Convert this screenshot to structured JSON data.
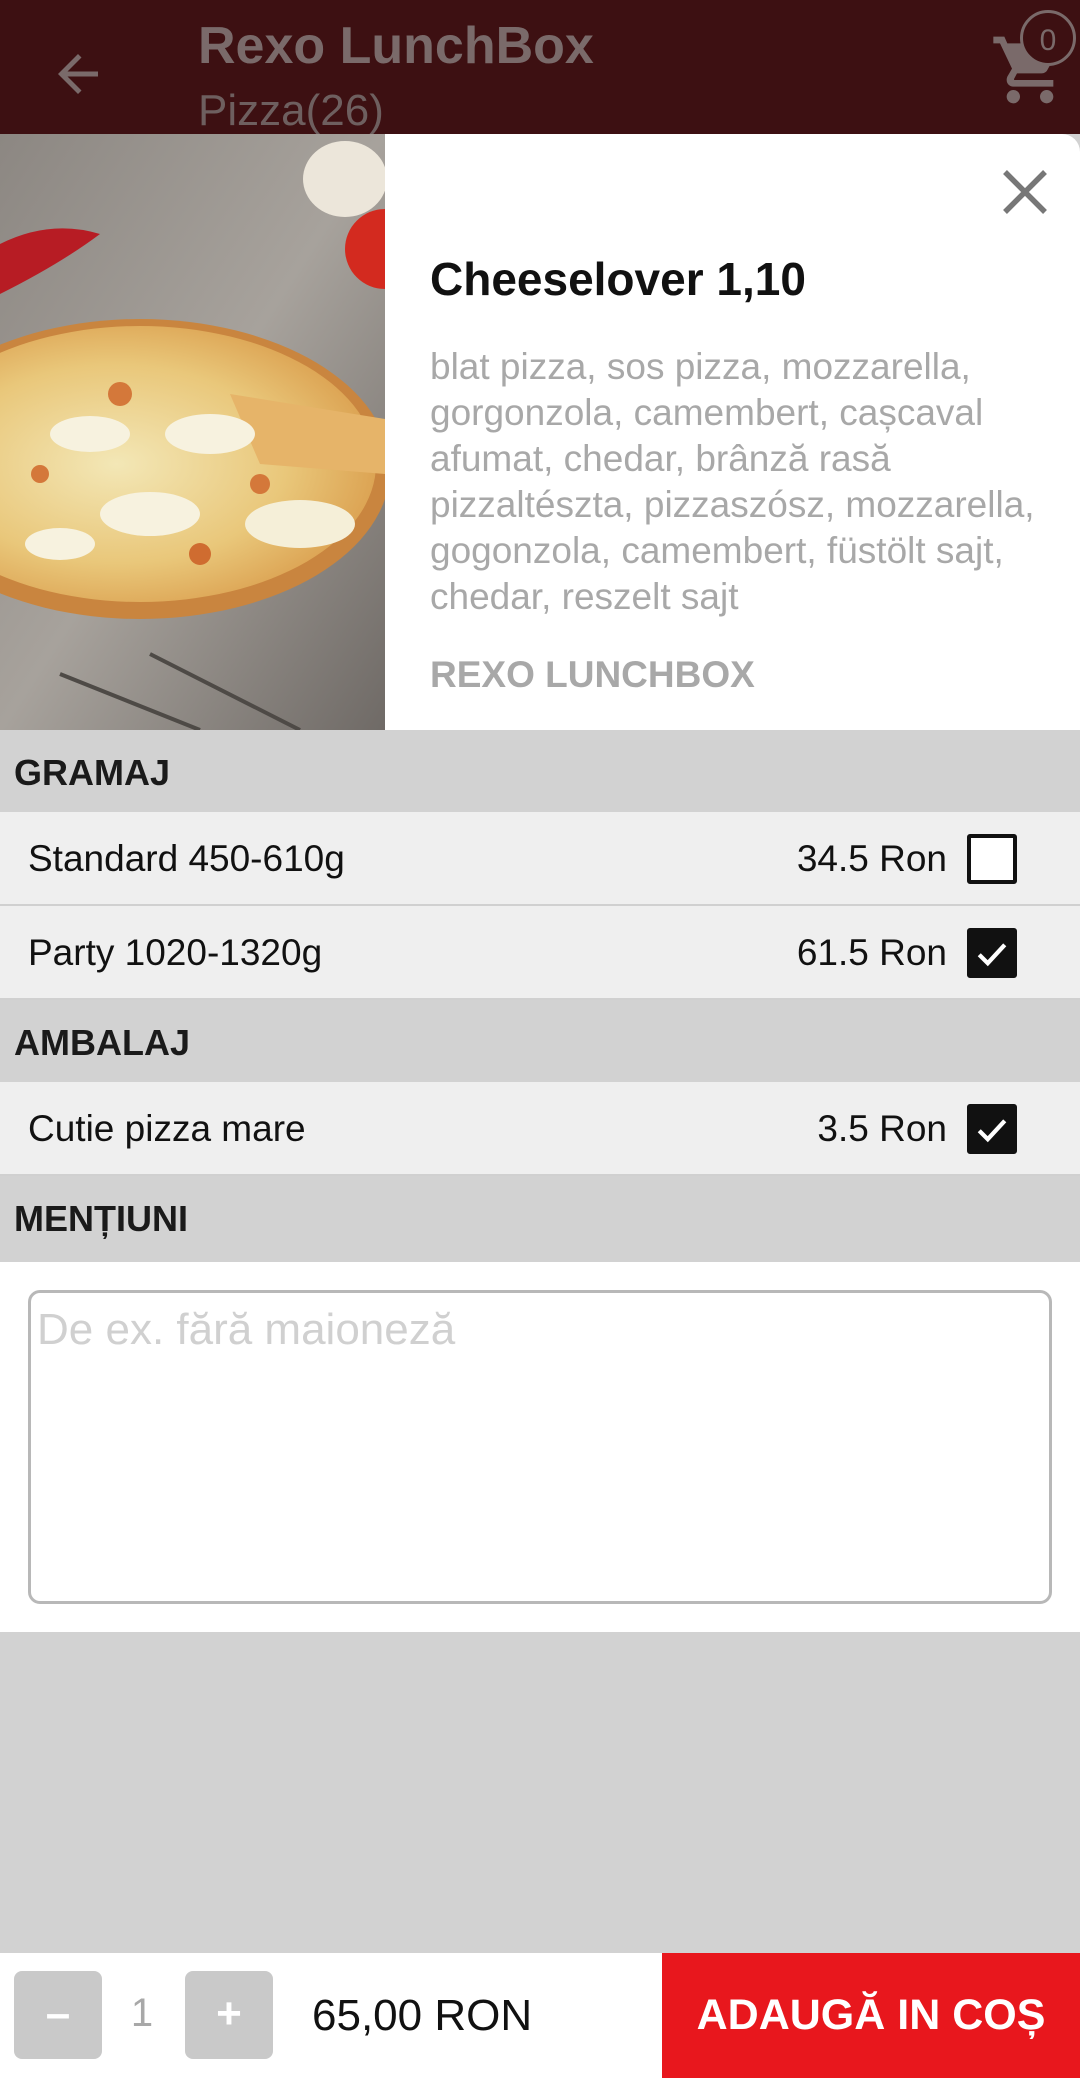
{
  "appbar": {
    "title": "Rexo LunchBox",
    "subtitle": "Pizza(26)",
    "cart_count": "0"
  },
  "product": {
    "name": "Cheeselover 1,10",
    "description": "blat pizza, sos pizza, mozzarella,\ngorgonzola, camembert, cașcaval\nafumat, chedar, brânză rasă\npizzaltészta, pizzaszósz, mozzarella,\ngogonzola, camembert, füstölt sajt,\nchedar, reszelt sajt",
    "vendor": "REXO LUNCHBOX"
  },
  "sections": {
    "gramaj": {
      "title": "GRAMAJ",
      "options": [
        {
          "label": "Standard 450-610g",
          "price": "34.5 Ron",
          "checked": false
        },
        {
          "label": "Party 1020-1320g",
          "price": "61.5 Ron",
          "checked": true
        }
      ]
    },
    "ambalaj": {
      "title": "AMBALAJ",
      "options": [
        {
          "label": "Cutie pizza mare",
          "price": "3.5 Ron",
          "checked": true
        }
      ]
    },
    "mentiuni": {
      "title": "MENȚIUNI",
      "placeholder": "De ex. fără maioneză",
      "value": ""
    }
  },
  "bottom": {
    "minus": "–",
    "quantity": "1",
    "plus": "+",
    "total": "65,00  RON",
    "add_label": "ADAUGĂ IN COȘ"
  },
  "colors": {
    "appbar": "#3d1012",
    "accent": "#e8171d",
    "section_bg": "#d2d2d2",
    "row_bg": "#efefef"
  }
}
